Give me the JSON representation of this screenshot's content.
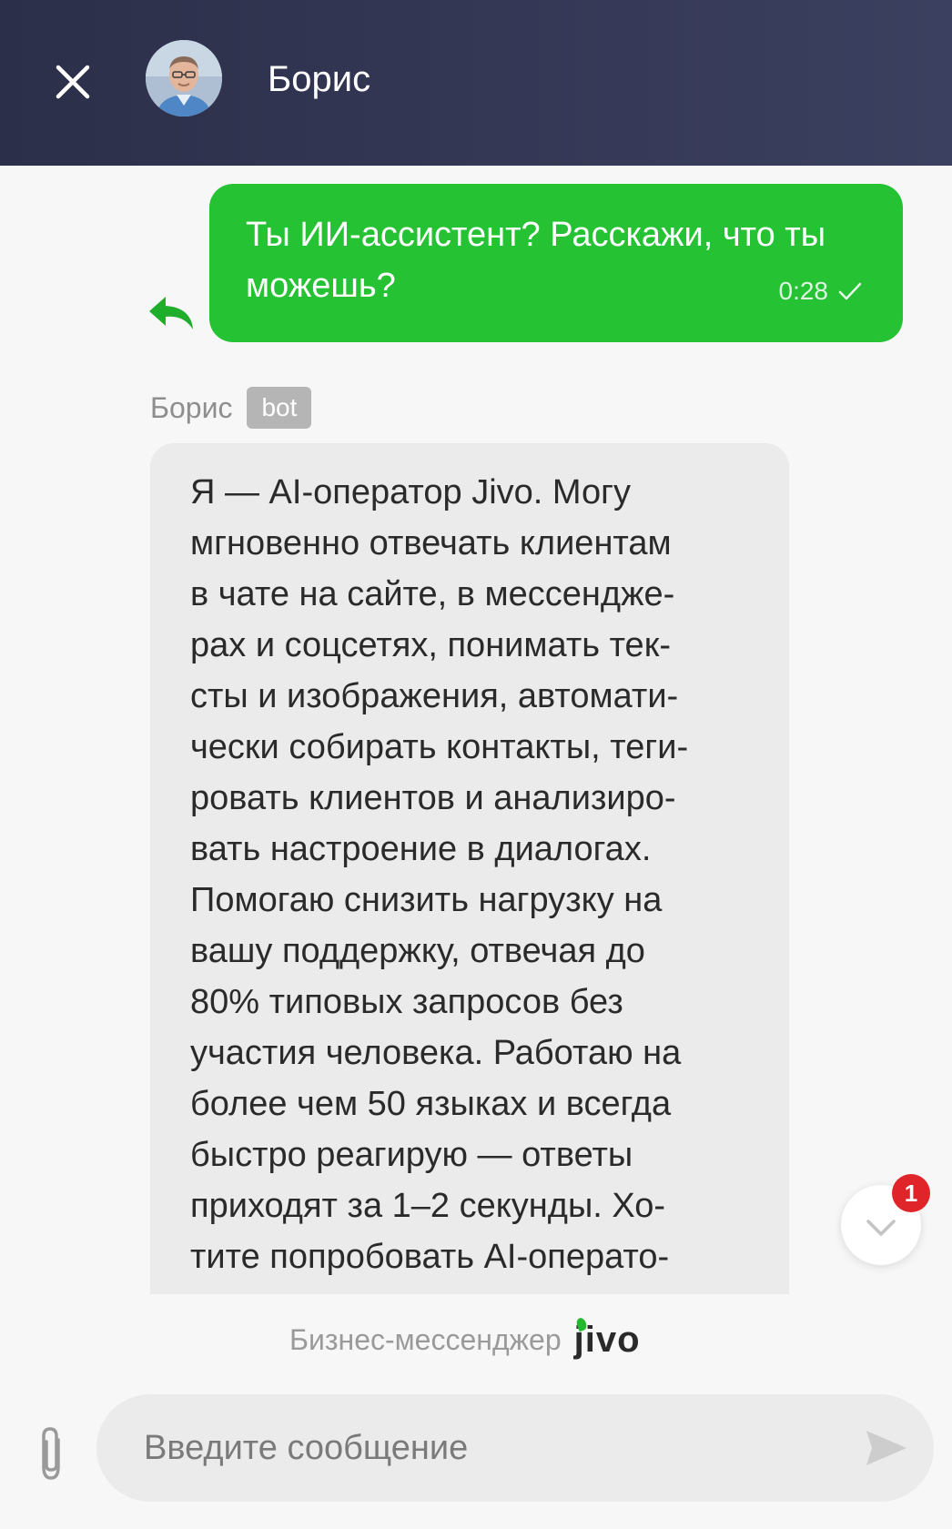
{
  "header": {
    "agent_name": "Борис",
    "close_icon": "close-icon",
    "avatar": "avatar"
  },
  "messages": {
    "user": {
      "text": "Ты ИИ-ассистент? Расскажи, что ты можешь?",
      "time": "0:28",
      "status_icon": "check-icon",
      "reply_icon": "reply-icon",
      "bubble_color": "#25c233"
    },
    "bot": {
      "sender_name": "Борис",
      "badge": "bot",
      "lines": [
        "Я — AI-оператор Jivo. Могу",
        "мгновенно отвечать клиентам",
        "в чате на сайте, в мессендже-",
        "рах и соцсетях, понимать тек-",
        "сты и изображения, автомати-",
        "чески собирать контакты, теги-",
        "ровать клиентов и анализиро-",
        "вать настроение в диалогах.",
        "Помогаю снизить нагрузку на",
        "вашу поддержку, отвечая до",
        "80% типовых запросов без",
        "участия человека. Работаю на",
        "более чем 50 языках и всегда",
        "быстро реагирую — ответы",
        "приходят за 1–2 секунды. Хо-",
        "тите попробовать AI-операто-"
      ]
    }
  },
  "scroll_down": {
    "icon": "chevron-down-icon",
    "unread_count": "1"
  },
  "branding": {
    "text": "Бизнес-мессенджер",
    "logo": "jivo"
  },
  "composer": {
    "placeholder": "Введите сообщение",
    "value": "",
    "attach_icon": "paperclip-icon",
    "send_icon": "send-icon"
  },
  "colors": {
    "header_bg": "#2b2f49",
    "accent_green": "#25c233",
    "badge_red": "#e0252a"
  }
}
